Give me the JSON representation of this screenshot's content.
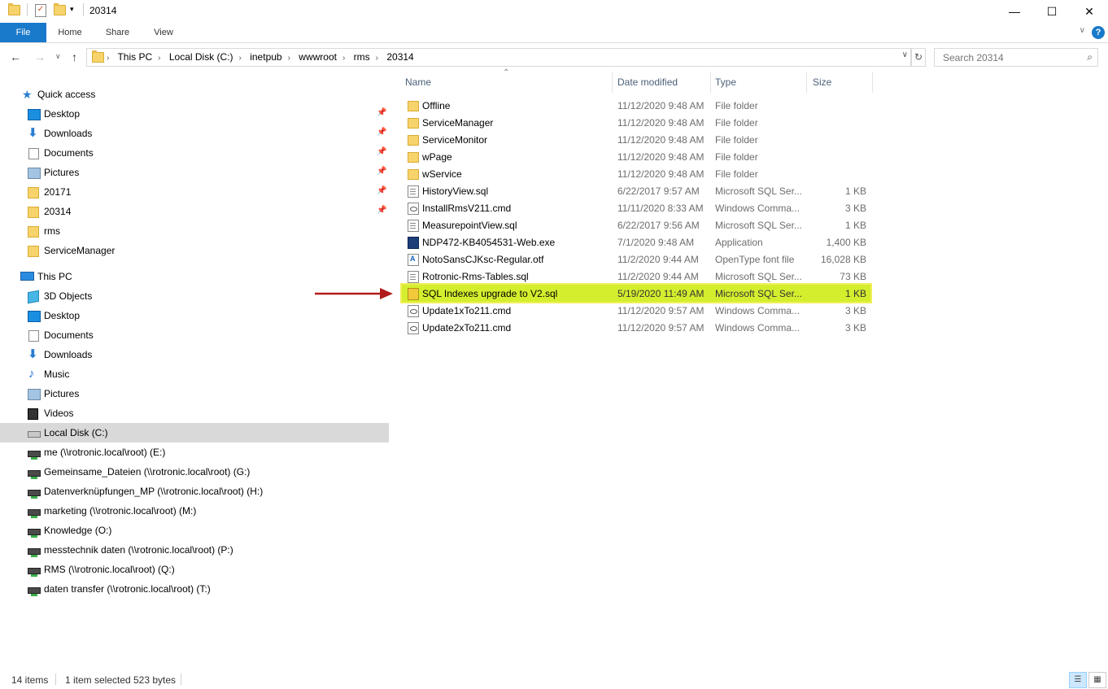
{
  "window": {
    "title": "20314",
    "minimize_glyph": "—",
    "maximize_glyph": "☐",
    "close_glyph": "✕"
  },
  "ribbon": {
    "tabs": [
      "File",
      "Home",
      "Share",
      "View"
    ],
    "expand_glyph": "∨",
    "help_glyph": "?"
  },
  "address": {
    "crumbs": [
      "This PC",
      "Local Disk (C:)",
      "inetpub",
      "wwwroot",
      "rms",
      "20314"
    ],
    "search_placeholder": "Search 20314"
  },
  "nav": {
    "quick_access": {
      "label": "Quick access",
      "icon": "star-icon"
    },
    "quick_items": [
      {
        "label": "Desktop",
        "icon": "desktop-icon",
        "pinned": true
      },
      {
        "label": "Downloads",
        "icon": "download-icon",
        "pinned": true
      },
      {
        "label": "Documents",
        "icon": "documents-icon",
        "pinned": true
      },
      {
        "label": "Pictures",
        "icon": "pictures-icon",
        "pinned": true
      },
      {
        "label": "20171",
        "icon": "folder-icon",
        "pinned": true
      },
      {
        "label": "20314",
        "icon": "folder-icon",
        "pinned": true
      },
      {
        "label": "rms",
        "icon": "folder-icon",
        "pinned": false
      },
      {
        "label": "ServiceManager",
        "icon": "folder-icon",
        "pinned": false
      }
    ],
    "this_pc": {
      "label": "This PC",
      "icon": "computer-icon"
    },
    "pc_items": [
      {
        "label": "3D Objects",
        "icon": "3d-objects-icon"
      },
      {
        "label": "Desktop",
        "icon": "desktop-icon"
      },
      {
        "label": "Documents",
        "icon": "documents-icon"
      },
      {
        "label": "Downloads",
        "icon": "download-icon"
      },
      {
        "label": "Music",
        "icon": "music-icon"
      },
      {
        "label": "Pictures",
        "icon": "pictures-icon"
      },
      {
        "label": "Videos",
        "icon": "videos-icon"
      },
      {
        "label": "Local Disk (C:)",
        "icon": "local-disk-icon",
        "selected": true
      },
      {
        "label": "me (\\\\rotronic.local\\root) (E:)",
        "icon": "network-drive-icon"
      },
      {
        "label": "Gemeinsame_Dateien (\\\\rotronic.local\\root) (G:)",
        "icon": "network-drive-icon"
      },
      {
        "label": "Datenverknüpfungen_MP (\\\\rotronic.local\\root) (H:)",
        "icon": "network-drive-icon"
      },
      {
        "label": "marketing (\\\\rotronic.local\\root) (M:)",
        "icon": "network-drive-icon"
      },
      {
        "label": "Knowledge (O:)",
        "icon": "network-drive-icon"
      },
      {
        "label": "messtechnik daten (\\\\rotronic.local\\root) (P:)",
        "icon": "network-drive-icon"
      },
      {
        "label": "RMS (\\\\rotronic.local\\root) (Q:)",
        "icon": "network-drive-icon"
      },
      {
        "label": "daten transfer (\\\\rotronic.local\\root) (T:)",
        "icon": "network-drive-icon"
      }
    ]
  },
  "columns": {
    "name": "Name",
    "date": "Date modified",
    "type": "Type",
    "size": "Size"
  },
  "files": [
    {
      "name": "Offline",
      "date": "11/12/2020 9:48 AM",
      "type": "File folder",
      "size": "",
      "icon": "folder"
    },
    {
      "name": "ServiceManager",
      "date": "11/12/2020 9:48 AM",
      "type": "File folder",
      "size": "",
      "icon": "folder"
    },
    {
      "name": "ServiceMonitor",
      "date": "11/12/2020 9:48 AM",
      "type": "File folder",
      "size": "",
      "icon": "folder"
    },
    {
      "name": "wPage",
      "date": "11/12/2020 9:48 AM",
      "type": "File folder",
      "size": "",
      "icon": "folder"
    },
    {
      "name": "wService",
      "date": "11/12/2020 9:48 AM",
      "type": "File folder",
      "size": "",
      "icon": "folder"
    },
    {
      "name": "HistoryView.sql",
      "date": "6/22/2017 9:57 AM",
      "type": "Microsoft SQL Ser...",
      "size": "1 KB",
      "icon": "sql"
    },
    {
      "name": "InstallRmsV211.cmd",
      "date": "11/11/2020 8:33 AM",
      "type": "Windows Comma...",
      "size": "3 KB",
      "icon": "cmd"
    },
    {
      "name": "MeasurepointView.sql",
      "date": "6/22/2017 9:56 AM",
      "type": "Microsoft SQL Ser...",
      "size": "1 KB",
      "icon": "sql"
    },
    {
      "name": "NDP472-KB4054531-Web.exe",
      "date": "7/1/2020 9:48 AM",
      "type": "Application",
      "size": "1,400 KB",
      "icon": "exe"
    },
    {
      "name": "NotoSansCJKsc-Regular.otf",
      "date": "11/2/2020 9:44 AM",
      "type": "OpenType font file",
      "size": "16,028 KB",
      "icon": "otf"
    },
    {
      "name": "Rotronic-Rms-Tables.sql",
      "date": "11/2/2020 9:44 AM",
      "type": "Microsoft SQL Ser...",
      "size": "73 KB",
      "icon": "sql"
    },
    {
      "name": "SQL Indexes upgrade to V2.sql",
      "date": "5/19/2020 11:49 AM",
      "type": "Microsoft SQL Ser...",
      "size": "1 KB",
      "icon": "sqlhl",
      "highlighted": true
    },
    {
      "name": "Update1xTo211.cmd",
      "date": "11/12/2020 9:57 AM",
      "type": "Windows Comma...",
      "size": "3 KB",
      "icon": "cmd"
    },
    {
      "name": "Update2xTo211.cmd",
      "date": "11/12/2020 9:57 AM",
      "type": "Windows Comma...",
      "size": "3 KB",
      "icon": "cmd"
    }
  ],
  "status": {
    "item_count": "14 items",
    "selection": "1 item selected",
    "selection_size": "523 bytes"
  },
  "colors": {
    "accent": "#1979ca",
    "highlight": "#d4ee2e",
    "arrow": "#b01c1c"
  }
}
